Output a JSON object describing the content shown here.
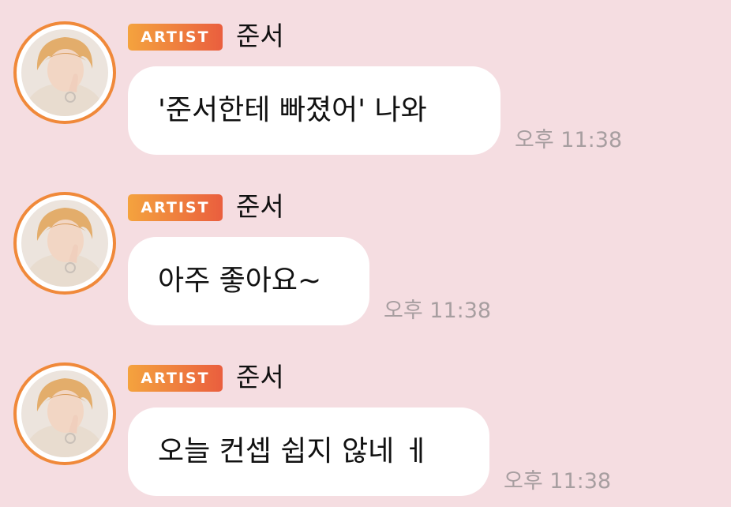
{
  "colors": {
    "background": "#f5dde1",
    "bubble": "#ffffff",
    "badge_gradient_start": "#f4a33e",
    "badge_gradient_end": "#ea5e3e",
    "avatar_ring": "#f0893a",
    "timestamp": "#a79ea0"
  },
  "messages": [
    {
      "badge": "ARTIST",
      "sender": "준서",
      "text": "'준서한테 빠졌어' 나와",
      "time": "오후 11:38",
      "avatar_icon": "profile-photo"
    },
    {
      "badge": "ARTIST",
      "sender": "준서",
      "text": "아주 좋아요~",
      "time": "오후 11:38",
      "avatar_icon": "profile-photo"
    },
    {
      "badge": "ARTIST",
      "sender": "준서",
      "text": "오늘 컨셉 쉽지 않네 ㅔ",
      "time": "오후 11:38",
      "avatar_icon": "profile-photo"
    }
  ]
}
